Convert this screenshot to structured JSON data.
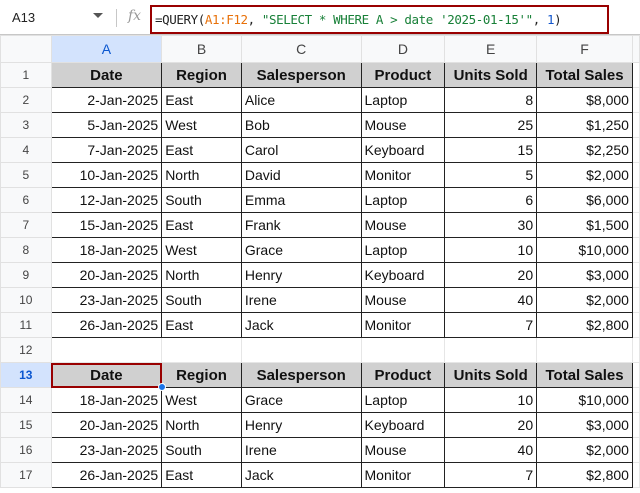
{
  "name_box": "A13",
  "formula": {
    "prefix": "=QUERY(",
    "range": "A1:F12",
    "sep1": ", ",
    "query": "\"SELECT * WHERE A > date '2025-01-15'\"",
    "sep2": ", ",
    "headers": "1",
    "suffix": ")"
  },
  "fx_label": "fx",
  "columns": [
    "A",
    "B",
    "C",
    "D",
    "E",
    "F"
  ],
  "headers": [
    "Date",
    "Region",
    "Salesperson",
    "Product",
    "Units Sold",
    "Total Sales"
  ],
  "source_rows": [
    [
      "2-Jan-2025",
      "East",
      "Alice",
      "Laptop",
      "8",
      "$8,000"
    ],
    [
      "5-Jan-2025",
      "West",
      "Bob",
      "Mouse",
      "25",
      "$1,250"
    ],
    [
      "7-Jan-2025",
      "East",
      "Carol",
      "Keyboard",
      "15",
      "$2,250"
    ],
    [
      "10-Jan-2025",
      "North",
      "David",
      "Monitor",
      "5",
      "$2,000"
    ],
    [
      "12-Jan-2025",
      "South",
      "Emma",
      "Laptop",
      "6",
      "$6,000"
    ],
    [
      "15-Jan-2025",
      "East",
      "Frank",
      "Mouse",
      "30",
      "$1,500"
    ],
    [
      "18-Jan-2025",
      "West",
      "Grace",
      "Laptop",
      "10",
      "$10,000"
    ],
    [
      "20-Jan-2025",
      "North",
      "Henry",
      "Keyboard",
      "20",
      "$3,000"
    ],
    [
      "23-Jan-2025",
      "South",
      "Irene",
      "Mouse",
      "40",
      "$2,000"
    ],
    [
      "26-Jan-2025",
      "East",
      "Jack",
      "Monitor",
      "7",
      "$2,800"
    ]
  ],
  "result_rows": [
    [
      "18-Jan-2025",
      "West",
      "Grace",
      "Laptop",
      "10",
      "$10,000"
    ],
    [
      "20-Jan-2025",
      "North",
      "Henry",
      "Keyboard",
      "20",
      "$3,000"
    ],
    [
      "23-Jan-2025",
      "South",
      "Irene",
      "Mouse",
      "40",
      "$2,000"
    ],
    [
      "26-Jan-2025",
      "East",
      "Jack",
      "Monitor",
      "7",
      "$2,800"
    ]
  ],
  "row_numbers": [
    "1",
    "2",
    "3",
    "4",
    "5",
    "6",
    "7",
    "8",
    "9",
    "10",
    "11",
    "12",
    "13",
    "14",
    "15",
    "16",
    "17"
  ]
}
